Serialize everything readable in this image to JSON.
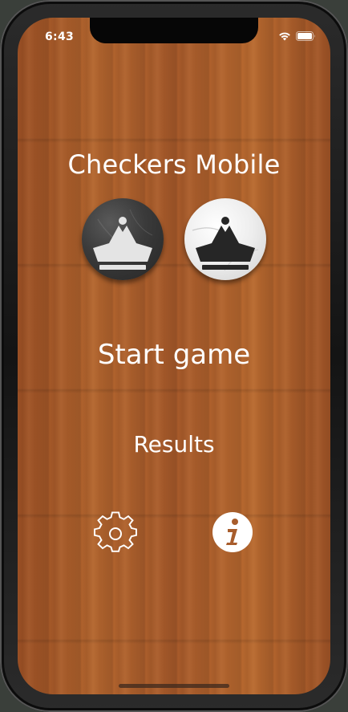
{
  "status_bar": {
    "time": "6:43",
    "icons": [
      "wifi-icon",
      "battery-icon"
    ]
  },
  "app": {
    "title": "Checkers Mobile"
  },
  "pieces": [
    {
      "name": "dark-king-piece",
      "color": "#2e2e2e",
      "icon": "crown-icon"
    },
    {
      "name": "light-king-piece",
      "color": "#eeeeee",
      "icon": "crown-icon"
    }
  ],
  "menu": {
    "start_label": "Start game",
    "results_label": "Results"
  },
  "icons": {
    "settings": "gear-icon",
    "info": "info-icon"
  },
  "colors": {
    "wood_background": "#a85d2c",
    "text": "#ffffff"
  }
}
